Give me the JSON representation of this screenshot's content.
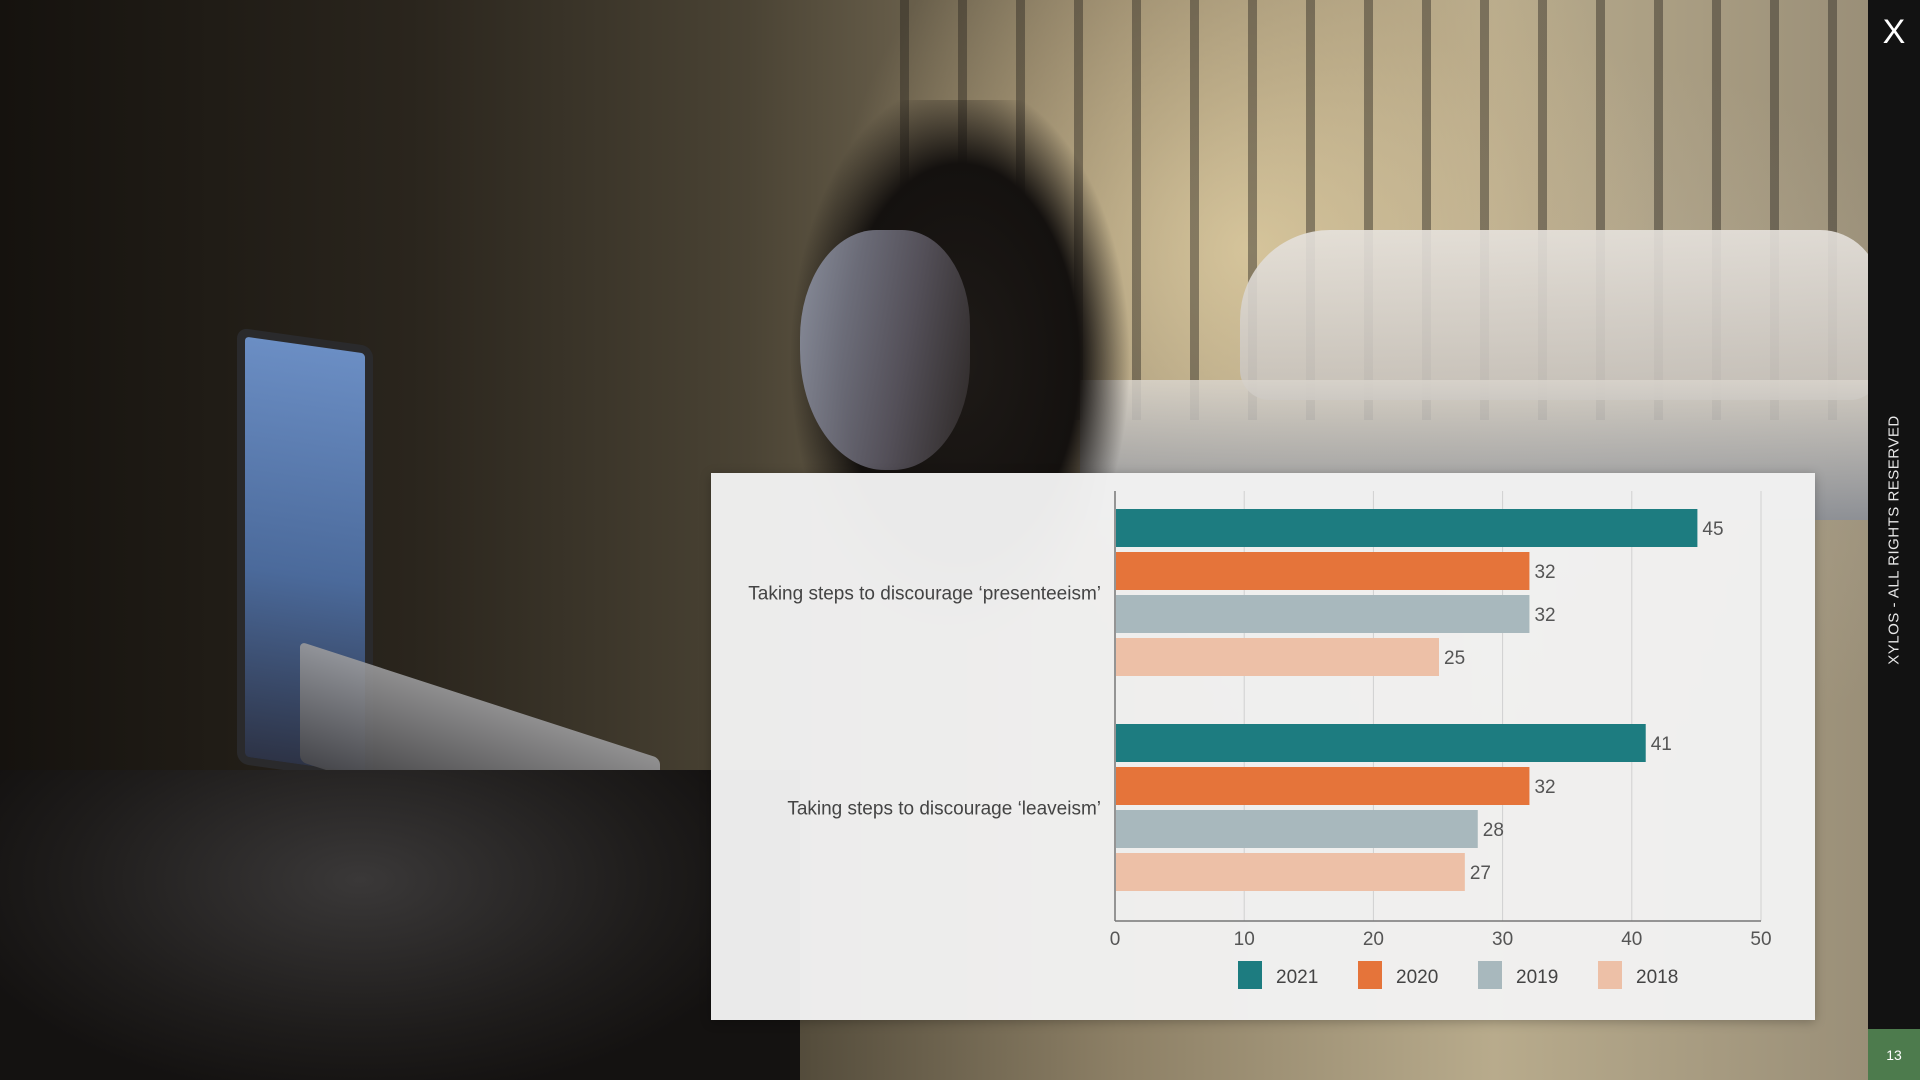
{
  "sidebar": {
    "close_label": "X",
    "rights_text": "XYLOS - ALL RIGHTS RESERVED",
    "page_number": "13"
  },
  "background": {
    "description_icon": "photo-woman-laptop-night"
  },
  "chart_data": {
    "type": "bar",
    "orientation": "horizontal",
    "categories": [
      "Taking steps to discourage ‘presenteeism’",
      "Taking steps to discourage ‘leaveism’"
    ],
    "series": [
      {
        "name": "2021",
        "color": "#1d7c80",
        "values": [
          45,
          41
        ]
      },
      {
        "name": "2020",
        "color": "#e5743a",
        "values": [
          32,
          32
        ]
      },
      {
        "name": "2019",
        "color": "#a8b8bd",
        "values": [
          32,
          28
        ]
      },
      {
        "name": "2018",
        "color": "#edc0a7",
        "values": [
          25,
          27
        ]
      }
    ],
    "x_ticks": [
      0,
      10,
      20,
      30,
      40,
      50
    ],
    "xlim": [
      0,
      50
    ],
    "grid": true,
    "legend_position": "bottom",
    "title": "",
    "xlabel": "",
    "ylabel": ""
  }
}
